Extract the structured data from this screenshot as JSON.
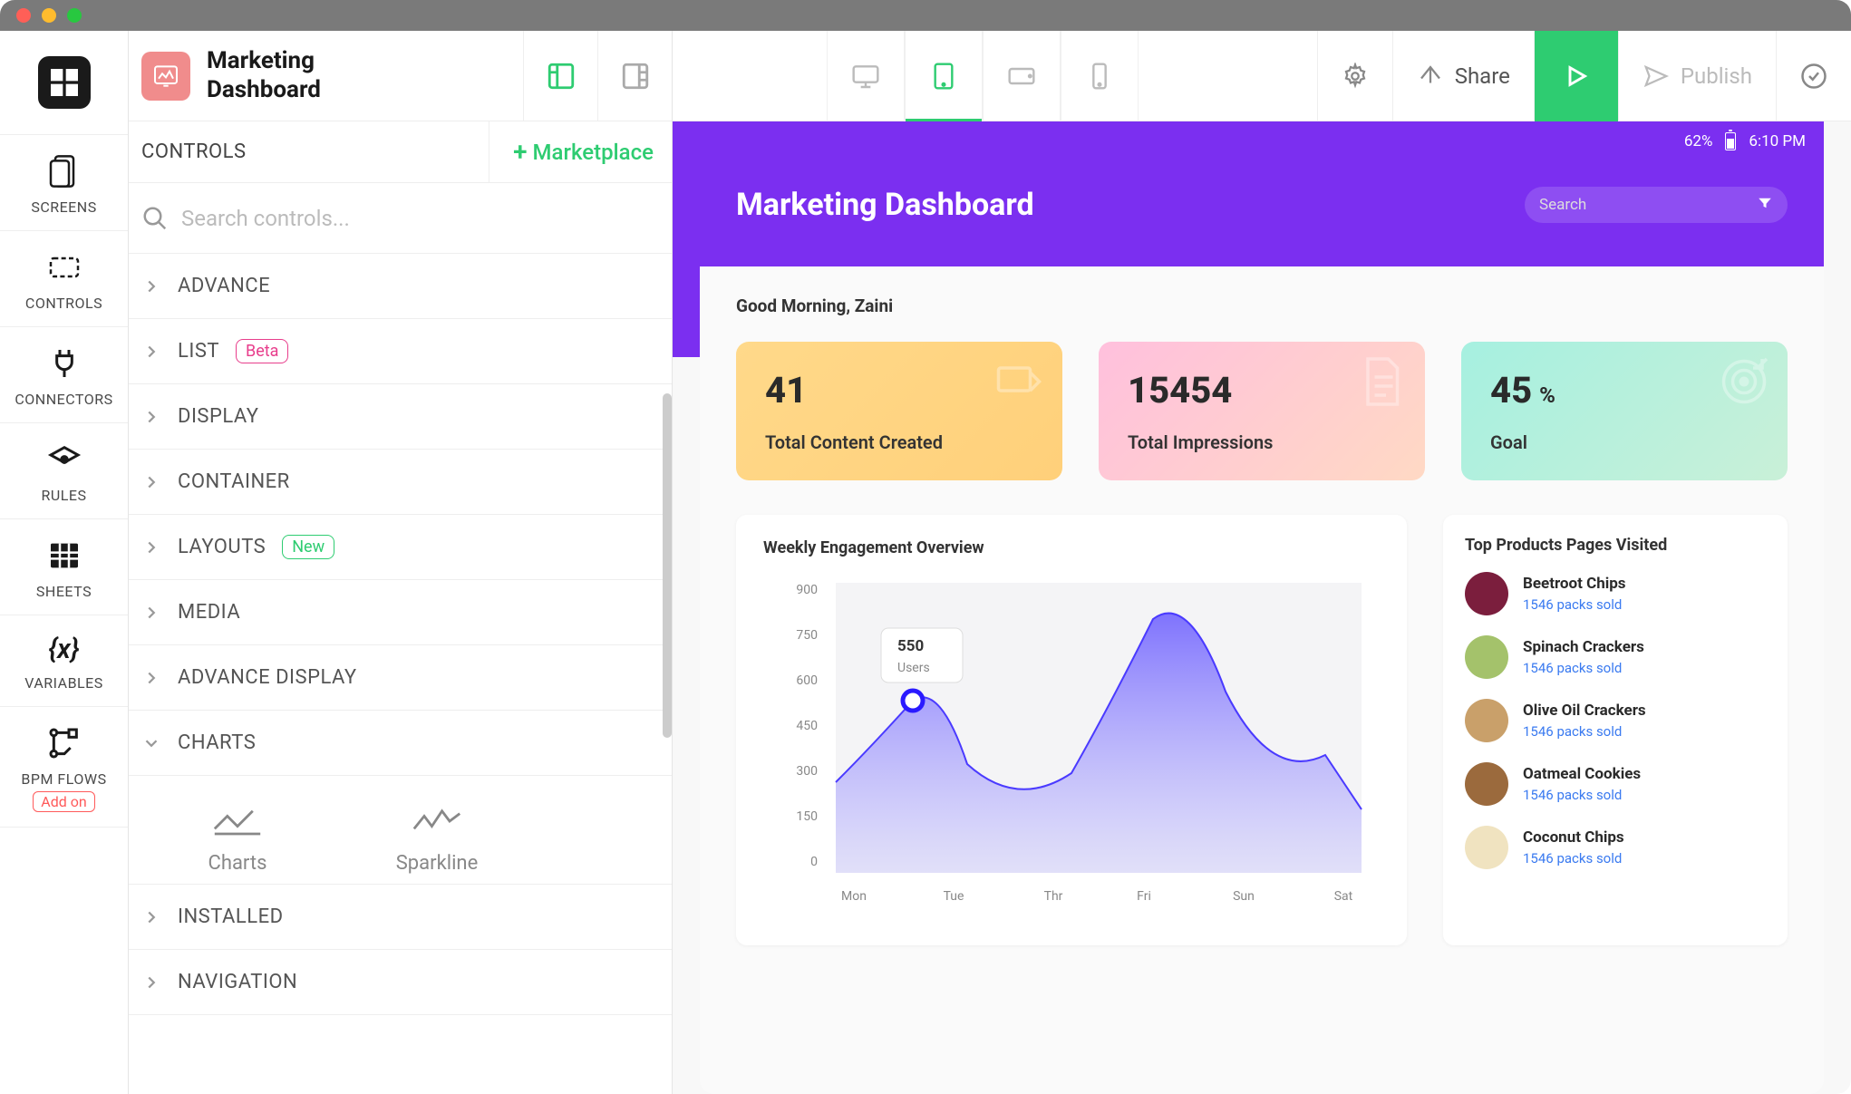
{
  "app": {
    "name": "Marketing Dashboard"
  },
  "leftnav": {
    "items": [
      {
        "label": "SCREENS"
      },
      {
        "label": "CONTROLS"
      },
      {
        "label": "CONNECTORS"
      },
      {
        "label": "RULES"
      },
      {
        "label": "SHEETS"
      },
      {
        "label": "VARIABLES"
      },
      {
        "label": "BPM FLOWS",
        "badge": "Add on"
      }
    ]
  },
  "panel": {
    "controls_label": "CONTROLS",
    "marketplace_label": "Marketplace",
    "search_placeholder": "Search controls...",
    "categories": [
      {
        "name": "ADVANCE"
      },
      {
        "name": "LIST",
        "badge": "Beta",
        "badgeClass": "badge-beta"
      },
      {
        "name": "DISPLAY"
      },
      {
        "name": "CONTAINER"
      },
      {
        "name": "LAYOUTS",
        "badge": "New",
        "badgeClass": "badge-new"
      },
      {
        "name": "MEDIA"
      },
      {
        "name": "ADVANCE DISPLAY"
      },
      {
        "name": "CHARTS",
        "expanded": true
      },
      {
        "name": "INSTALLED"
      },
      {
        "name": "NAVIGATION"
      }
    ],
    "chart_tiles": [
      {
        "label": "Charts"
      },
      {
        "label": "Sparkline"
      }
    ]
  },
  "topbar": {
    "share_label": "Share",
    "publish_label": "Publish"
  },
  "device": {
    "battery_pct": "62%",
    "time": "6:10 PM",
    "hero_title": "Marketing Dashboard",
    "search_placeholder": "Search",
    "greeting": "Good Morning, Zaini",
    "stats": [
      {
        "value": "41",
        "label": "Total Content Created"
      },
      {
        "value": "15454",
        "label": "Total Impressions"
      },
      {
        "value": "45",
        "unit": "%",
        "label": "Goal"
      }
    ],
    "chart_title": "Weekly Engagement Overview",
    "products_title": "Top Products Pages Visited",
    "products": [
      {
        "name": "Beetroot Chips",
        "sub": "1546 packs sold",
        "c": "#7b1e3d"
      },
      {
        "name": "Spinach Crackers",
        "sub": "1546 packs sold",
        "c": "#a4c26b"
      },
      {
        "name": "Olive Oil Crackers",
        "sub": "1546 packs sold",
        "c": "#c9a06a"
      },
      {
        "name": "Oatmeal Cookies",
        "sub": "1546 packs sold",
        "c": "#9b6a3d"
      },
      {
        "name": "Coconut Chips",
        "sub": "1546 packs sold",
        "c": "#f0e3c0"
      }
    ],
    "tooltip": {
      "value": "550",
      "label": "Users"
    }
  },
  "chart_data": {
    "type": "area",
    "title": "Weekly Engagement Overview",
    "xlabel": "",
    "ylabel": "",
    "ylim": [
      0,
      900
    ],
    "yticks": [
      0,
      150,
      300,
      450,
      600,
      750,
      900
    ],
    "categories": [
      "Mon",
      "Tue",
      "Thr",
      "Fri",
      "Sun",
      "Sat"
    ],
    "values": [
      280,
      550,
      320,
      870,
      520,
      380
    ],
    "tooltip": {
      "category": "Tue",
      "value": 550,
      "label": "Users"
    }
  }
}
